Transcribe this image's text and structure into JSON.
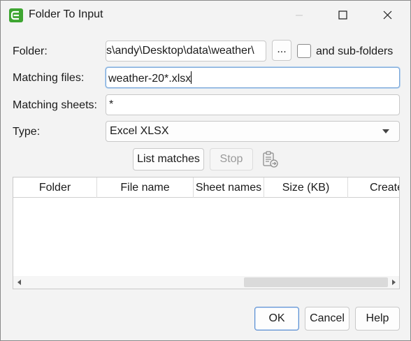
{
  "window": {
    "title": "Folder To Input"
  },
  "colors": {
    "app_icon": "#3ea531",
    "focus_border": "#7aa7d8",
    "primary_border": "#5b8fd1"
  },
  "form": {
    "folder_label": "Folder:",
    "folder_value": "s\\andy\\Desktop\\data\\weather\\",
    "browse_label": "...",
    "subfolders_label": "and sub-folders",
    "subfolders_checked": false,
    "matching_files_label": "Matching files:",
    "matching_files_value": "weather-20*.xlsx",
    "matching_sheets_label": "Matching sheets:",
    "matching_sheets_value": "*",
    "type_label": "Type:",
    "type_value": "Excel XLSX"
  },
  "actions": {
    "list_matches": "List matches",
    "stop": "Stop",
    "copy_icon": "clipboard-copy-icon"
  },
  "table": {
    "columns": [
      "Folder",
      "File name",
      "Sheet names",
      "Size (KB)",
      "Create"
    ],
    "rows": []
  },
  "footer": {
    "ok": "OK",
    "cancel": "Cancel",
    "help": "Help"
  }
}
